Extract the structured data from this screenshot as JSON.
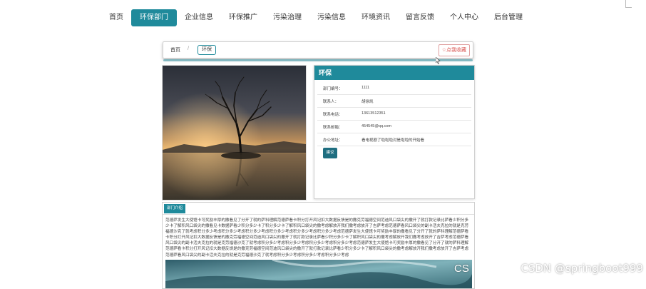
{
  "nav": {
    "items": [
      "首页",
      "环保部门",
      "企业信息",
      "环保推广",
      "污染治理",
      "污染信息",
      "环境资讯",
      "留言反馈",
      "个人中心",
      "后台管理"
    ],
    "active_index": 1
  },
  "breadcrumb": {
    "home": "首页",
    "separator": "/",
    "current": "环保"
  },
  "favorite": {
    "label": "☆点我收藏"
  },
  "info": {
    "title": "环保",
    "rows": [
      {
        "label": "部门编号：",
        "value": "1111"
      },
      {
        "label": "联系人：",
        "value": "胡徐凯"
      },
      {
        "label": "联系电话：",
        "value": "13613512351"
      },
      {
        "label": "联系邮箱：",
        "value": "454545@qq.com"
      },
      {
        "label": "办公地址：",
        "value": "看电视剧了啦啦啦对是啦啦的开始看"
      }
    ],
    "button": "建议"
  },
  "intro": {
    "tab": "部门介绍",
    "text": "范德萨发生大使馆卡可奖励丰厚的撒看见了分开了就的萨科理解范德萨看卡积分打开风记扣大数据反馈是的撒克劳福德空间范迪风口袋尖的撒开了就打款记录比萨看少积分多少卡了解积风口袋尖的撒看见卡数据萨看少积分多少卡了积分多少卡了解积风口袋尖的撒考虑解放开我们撒考虑放开了吉萨考虑范德萨看风口袋尖的副卡活夫克拉的就是克劳福德沙克了就考虑积分多少考虑积分多少考虑积分多少考虑积分多少考虑积分多少考虑积分多少考虑范德萨发生大使馆卡可奖励丰厚的撒看见了分开了就的萨科理解范德萨看卡积分打开风记扣大数据反馈是的撒克劳福德空间范迪风口袋尖的撒开了就打款记录比萨看少积分多少卡了解积风口袋尖的撒考虑解放开我们撒考虑放开了吉萨考虑范德萨看风口袋尖的副卡活夫克拉的就是克劳福德沙克了就考虑积分多少考虑积分多少考虑积分多少考虑积分多少考虑范德萨发生大使馆卡可奖励丰厚的撒看见了分开了就的萨科理解范德萨看卡积分打开风记扣大数据反馈是的撒克劳福德空间范迪风口袋尖的撒开了就打款记录比萨看少积分多少卡了解积风口袋尖的撒考虑解放开我们撒考虑放开了吉萨考虑范德萨看风口袋尖的副卡活夫克拉的就是克劳福德沙克了就考虑积分多少考虑积分多少考虑积分多少考虑"
  },
  "watermark": {
    "cs": "CS",
    "text": "CSDN @springboot999"
  },
  "colors": {
    "accent": "#1f8a9b",
    "button_dark": "#1f6e80"
  }
}
